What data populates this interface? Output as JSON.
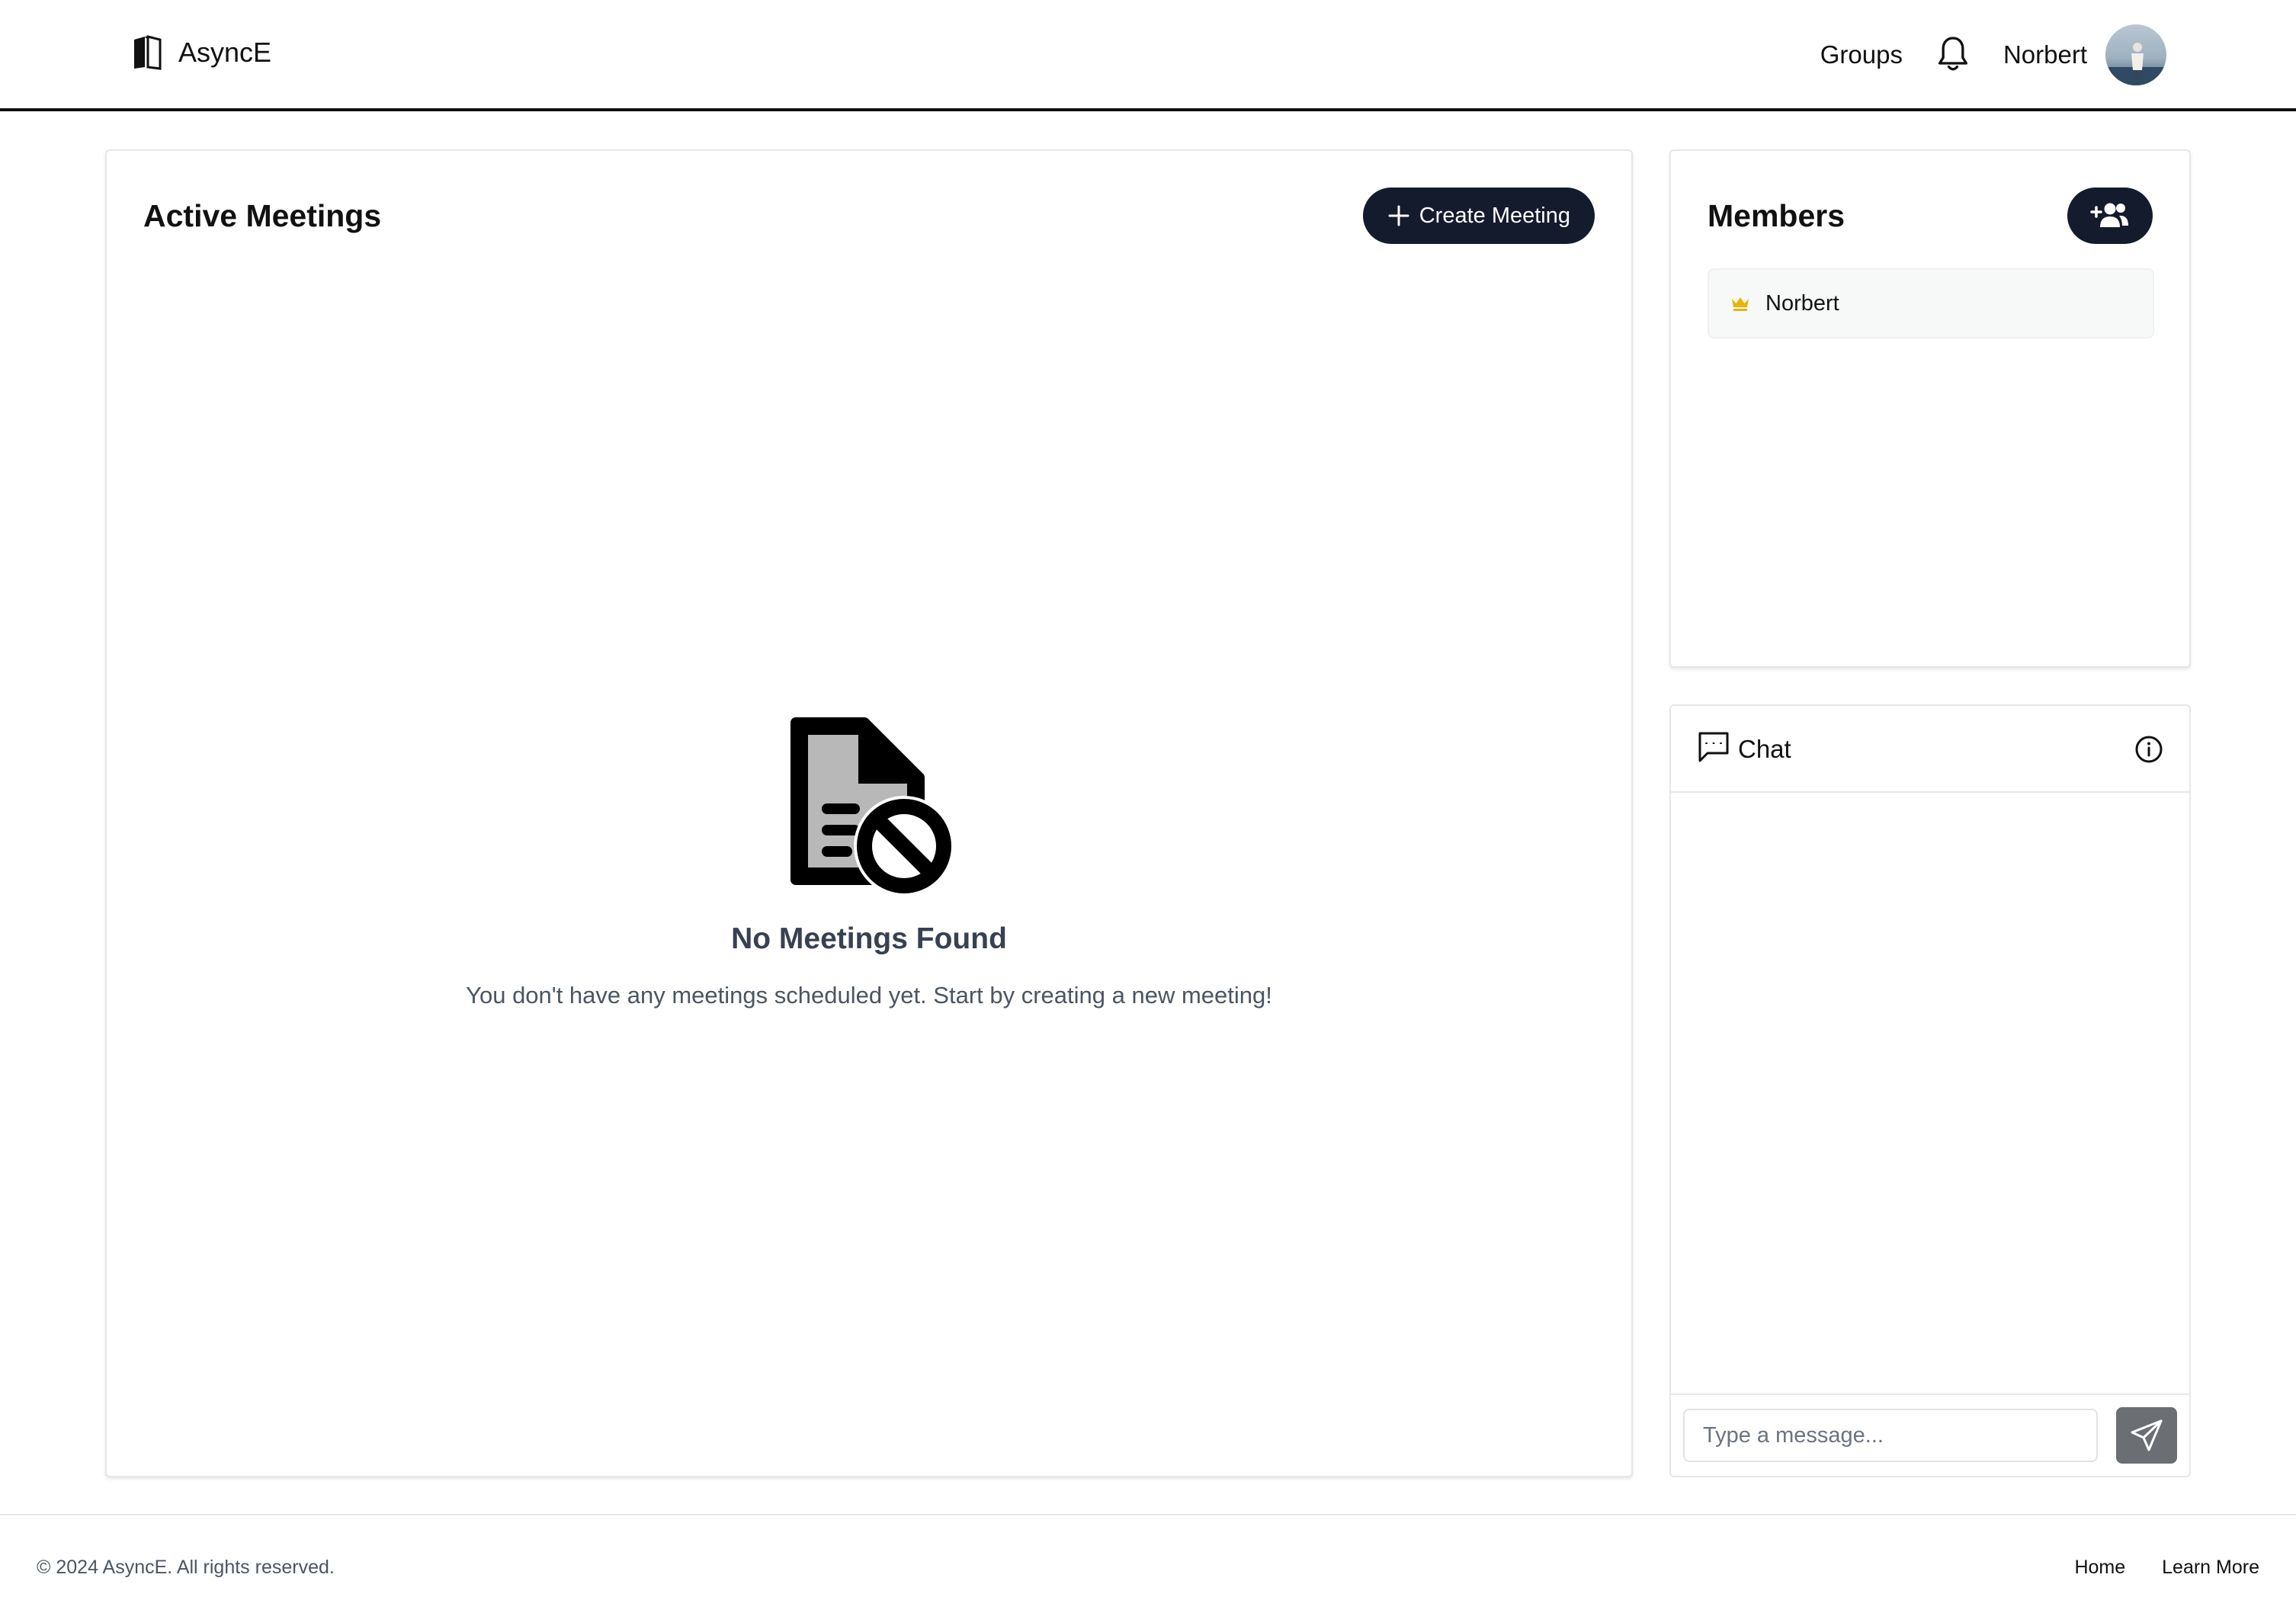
{
  "header": {
    "brand": "AsyncE",
    "nav_groups": "Groups",
    "user_name": "Norbert"
  },
  "meetings": {
    "title": "Active Meetings",
    "create_label": "Create Meeting",
    "empty_title": "No Meetings Found",
    "empty_text": "You don't have any meetings scheduled yet. Start by creating a new meeting!"
  },
  "members": {
    "title": "Members",
    "items": [
      {
        "name": "Norbert",
        "role_icon": "crown-icon"
      }
    ]
  },
  "chat": {
    "title": "Chat",
    "input_placeholder": "Type a message..."
  },
  "footer": {
    "copyright": "© 2024 AsyncE. All rights reserved.",
    "links": [
      "Home",
      "Learn More"
    ]
  },
  "colors": {
    "primary_button": "#141b2d",
    "crown": "#eab308",
    "send_button": "#6b6f73"
  }
}
